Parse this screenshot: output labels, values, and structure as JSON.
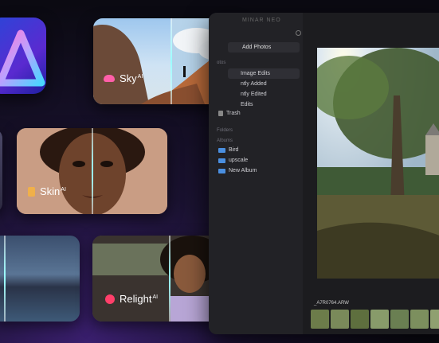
{
  "app": {
    "title": "MINAR NEO",
    "add_photos": "Add Photos",
    "sections": {
      "photos_head": "otos",
      "folders_head": "Folders",
      "albums_head": "Albums"
    },
    "menu": [
      "Image Edits",
      "ntly Added",
      "ntly Edited",
      "Edits",
      "Trash"
    ],
    "albums": [
      "Bird",
      "upscale",
      "New Album"
    ],
    "filename": "_A7R0764.ARW"
  },
  "cards": {
    "sky": "Sky",
    "skin": "Skin",
    "relight": "Relight",
    "ai": "AI"
  },
  "colors": {
    "accent_blue": "#4a8fe0",
    "sky_icon": "#ff5fa8",
    "skin_icon": "#f0b04a",
    "relight_icon": "#ff3f6a"
  }
}
